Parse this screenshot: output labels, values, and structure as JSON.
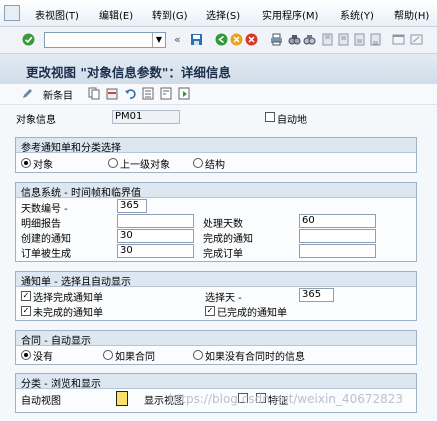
{
  "menu": {
    "items": [
      "表视图(T)",
      "编辑(E)",
      "转到(G)",
      "选择(S)",
      "实用程序(M)",
      "系统(Y)",
      "帮助(H)"
    ]
  },
  "toolbar": {
    "command_value": ""
  },
  "title": "更改视图 \"对象信息参数\"：详细信息",
  "app_toolbar": {
    "new_entries_label": "新条目"
  },
  "header": {
    "object_label": "对象信息",
    "object_value": "PM01",
    "auto_label": "自动地"
  },
  "ref_group": {
    "title": "参考通知单和分类选择",
    "options": [
      "对象",
      "上一级对象",
      "结构"
    ]
  },
  "info_group": {
    "title": "信息系统 - 时间帧和临界值",
    "days_label": "天数编号 -",
    "days_value": "365",
    "detail_report_label": "明细报告",
    "detail_report_value": "",
    "created_label": "创建的通知",
    "created_value": "30",
    "orders_created_label": "订单被生成",
    "orders_created_value": "30",
    "processing_days_label": "处理天数",
    "processing_days_value": "60",
    "completed_notif_label": "完成的通知",
    "completed_notif_value": "",
    "completed_orders_label": "完成订单",
    "completed_orders_value": ""
  },
  "notif_group": {
    "title": "通知单 - 选择且自动显示",
    "select_completed_label": "选择完成通知单",
    "uncompleted_label": "未完成的通知单",
    "select_days_label": "选择天 -",
    "select_days_value": "365",
    "done_label": "已完成的通知单"
  },
  "contract_group": {
    "title": "合同 - 自动显示",
    "options": [
      "没有",
      "如果合同",
      "如果没有合同时的信息"
    ]
  },
  "class_group": {
    "title": "分类 - 浏览和显示",
    "auto_view_label": "自动视图",
    "display_view_label": "显示视图",
    "feature_label": "特征"
  },
  "watermark": "https://blog.csdn.net/weixin_40672823"
}
